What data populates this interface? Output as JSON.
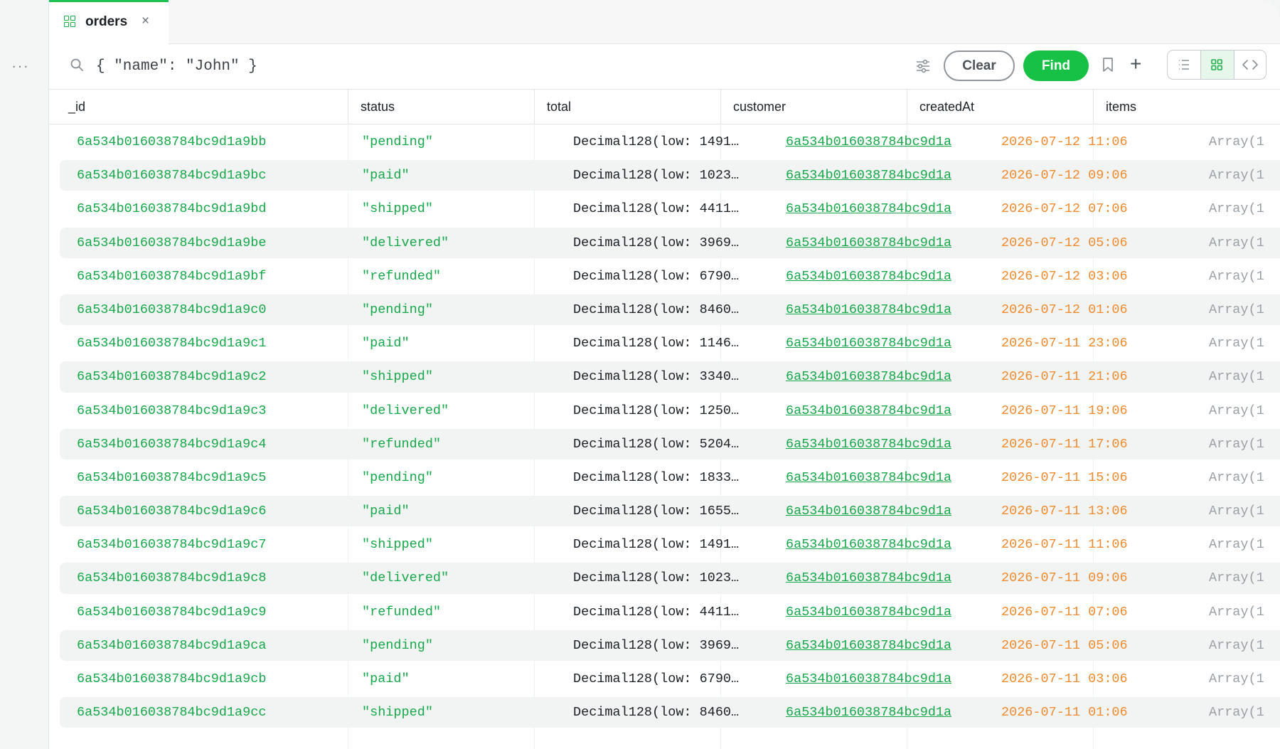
{
  "rail": {
    "more_label": "···"
  },
  "tab": {
    "label": "orders",
    "close": "×",
    "icon": "grid-icon"
  },
  "query": {
    "value": "",
    "placeholder": "{ \"name\": \"John\" }"
  },
  "toolbar": {
    "clear_label": "Clear",
    "find_label": "Find",
    "add_label": "+"
  },
  "colors": {
    "accent": "#16c146",
    "id_text": "#16a84a",
    "date_text": "#f08a2e",
    "muted": "#9aa0a5"
  },
  "columns": [
    "_id",
    "status",
    "total",
    "customer",
    "createdAt",
    "items"
  ],
  "rows": [
    {
      "id": "6a534b016038784bc9d1a9bb",
      "status": "\"pending\"",
      "total": "Decimal128(low: 1491…",
      "customer": "6a534b016038784bc9d1a",
      "createdAt": "2026-07-12 11:06",
      "items": "Array(1"
    },
    {
      "id": "6a534b016038784bc9d1a9bc",
      "status": "\"paid\"",
      "total": "Decimal128(low: 1023…",
      "customer": "6a534b016038784bc9d1a",
      "createdAt": "2026-07-12 09:06",
      "items": "Array(1"
    },
    {
      "id": "6a534b016038784bc9d1a9bd",
      "status": "\"shipped\"",
      "total": "Decimal128(low: 4411…",
      "customer": "6a534b016038784bc9d1a",
      "createdAt": "2026-07-12 07:06",
      "items": "Array(1"
    },
    {
      "id": "6a534b016038784bc9d1a9be",
      "status": "\"delivered\"",
      "total": "Decimal128(low: 3969…",
      "customer": "6a534b016038784bc9d1a",
      "createdAt": "2026-07-12 05:06",
      "items": "Array(1"
    },
    {
      "id": "6a534b016038784bc9d1a9bf",
      "status": "\"refunded\"",
      "total": "Decimal128(low: 6790…",
      "customer": "6a534b016038784bc9d1a",
      "createdAt": "2026-07-12 03:06",
      "items": "Array(1"
    },
    {
      "id": "6a534b016038784bc9d1a9c0",
      "status": "\"pending\"",
      "total": "Decimal128(low: 8460…",
      "customer": "6a534b016038784bc9d1a",
      "createdAt": "2026-07-12 01:06",
      "items": "Array(1"
    },
    {
      "id": "6a534b016038784bc9d1a9c1",
      "status": "\"paid\"",
      "total": "Decimal128(low: 1146…",
      "customer": "6a534b016038784bc9d1a",
      "createdAt": "2026-07-11 23:06",
      "items": "Array(1"
    },
    {
      "id": "6a534b016038784bc9d1a9c2",
      "status": "\"shipped\"",
      "total": "Decimal128(low: 3340…",
      "customer": "6a534b016038784bc9d1a",
      "createdAt": "2026-07-11 21:06",
      "items": "Array(1"
    },
    {
      "id": "6a534b016038784bc9d1a9c3",
      "status": "\"delivered\"",
      "total": "Decimal128(low: 1250…",
      "customer": "6a534b016038784bc9d1a",
      "createdAt": "2026-07-11 19:06",
      "items": "Array(1"
    },
    {
      "id": "6a534b016038784bc9d1a9c4",
      "status": "\"refunded\"",
      "total": "Decimal128(low: 5204…",
      "customer": "6a534b016038784bc9d1a",
      "createdAt": "2026-07-11 17:06",
      "items": "Array(1"
    },
    {
      "id": "6a534b016038784bc9d1a9c5",
      "status": "\"pending\"",
      "total": "Decimal128(low: 1833…",
      "customer": "6a534b016038784bc9d1a",
      "createdAt": "2026-07-11 15:06",
      "items": "Array(1"
    },
    {
      "id": "6a534b016038784bc9d1a9c6",
      "status": "\"paid\"",
      "total": "Decimal128(low: 1655…",
      "customer": "6a534b016038784bc9d1a",
      "createdAt": "2026-07-11 13:06",
      "items": "Array(1"
    },
    {
      "id": "6a534b016038784bc9d1a9c7",
      "status": "\"shipped\"",
      "total": "Decimal128(low: 1491…",
      "customer": "6a534b016038784bc9d1a",
      "createdAt": "2026-07-11 11:06",
      "items": "Array(1"
    },
    {
      "id": "6a534b016038784bc9d1a9c8",
      "status": "\"delivered\"",
      "total": "Decimal128(low: 1023…",
      "customer": "6a534b016038784bc9d1a",
      "createdAt": "2026-07-11 09:06",
      "items": "Array(1"
    },
    {
      "id": "6a534b016038784bc9d1a9c9",
      "status": "\"refunded\"",
      "total": "Decimal128(low: 4411…",
      "customer": "6a534b016038784bc9d1a",
      "createdAt": "2026-07-11 07:06",
      "items": "Array(1"
    },
    {
      "id": "6a534b016038784bc9d1a9ca",
      "status": "\"pending\"",
      "total": "Decimal128(low: 3969…",
      "customer": "6a534b016038784bc9d1a",
      "createdAt": "2026-07-11 05:06",
      "items": "Array(1"
    },
    {
      "id": "6a534b016038784bc9d1a9cb",
      "status": "\"paid\"",
      "total": "Decimal128(low: 6790…",
      "customer": "6a534b016038784bc9d1a",
      "createdAt": "2026-07-11 03:06",
      "items": "Array(1"
    },
    {
      "id": "6a534b016038784bc9d1a9cc",
      "status": "\"shipped\"",
      "total": "Decimal128(low: 8460…",
      "customer": "6a534b016038784bc9d1a",
      "createdAt": "2026-07-11 01:06",
      "items": "Array(1"
    }
  ]
}
